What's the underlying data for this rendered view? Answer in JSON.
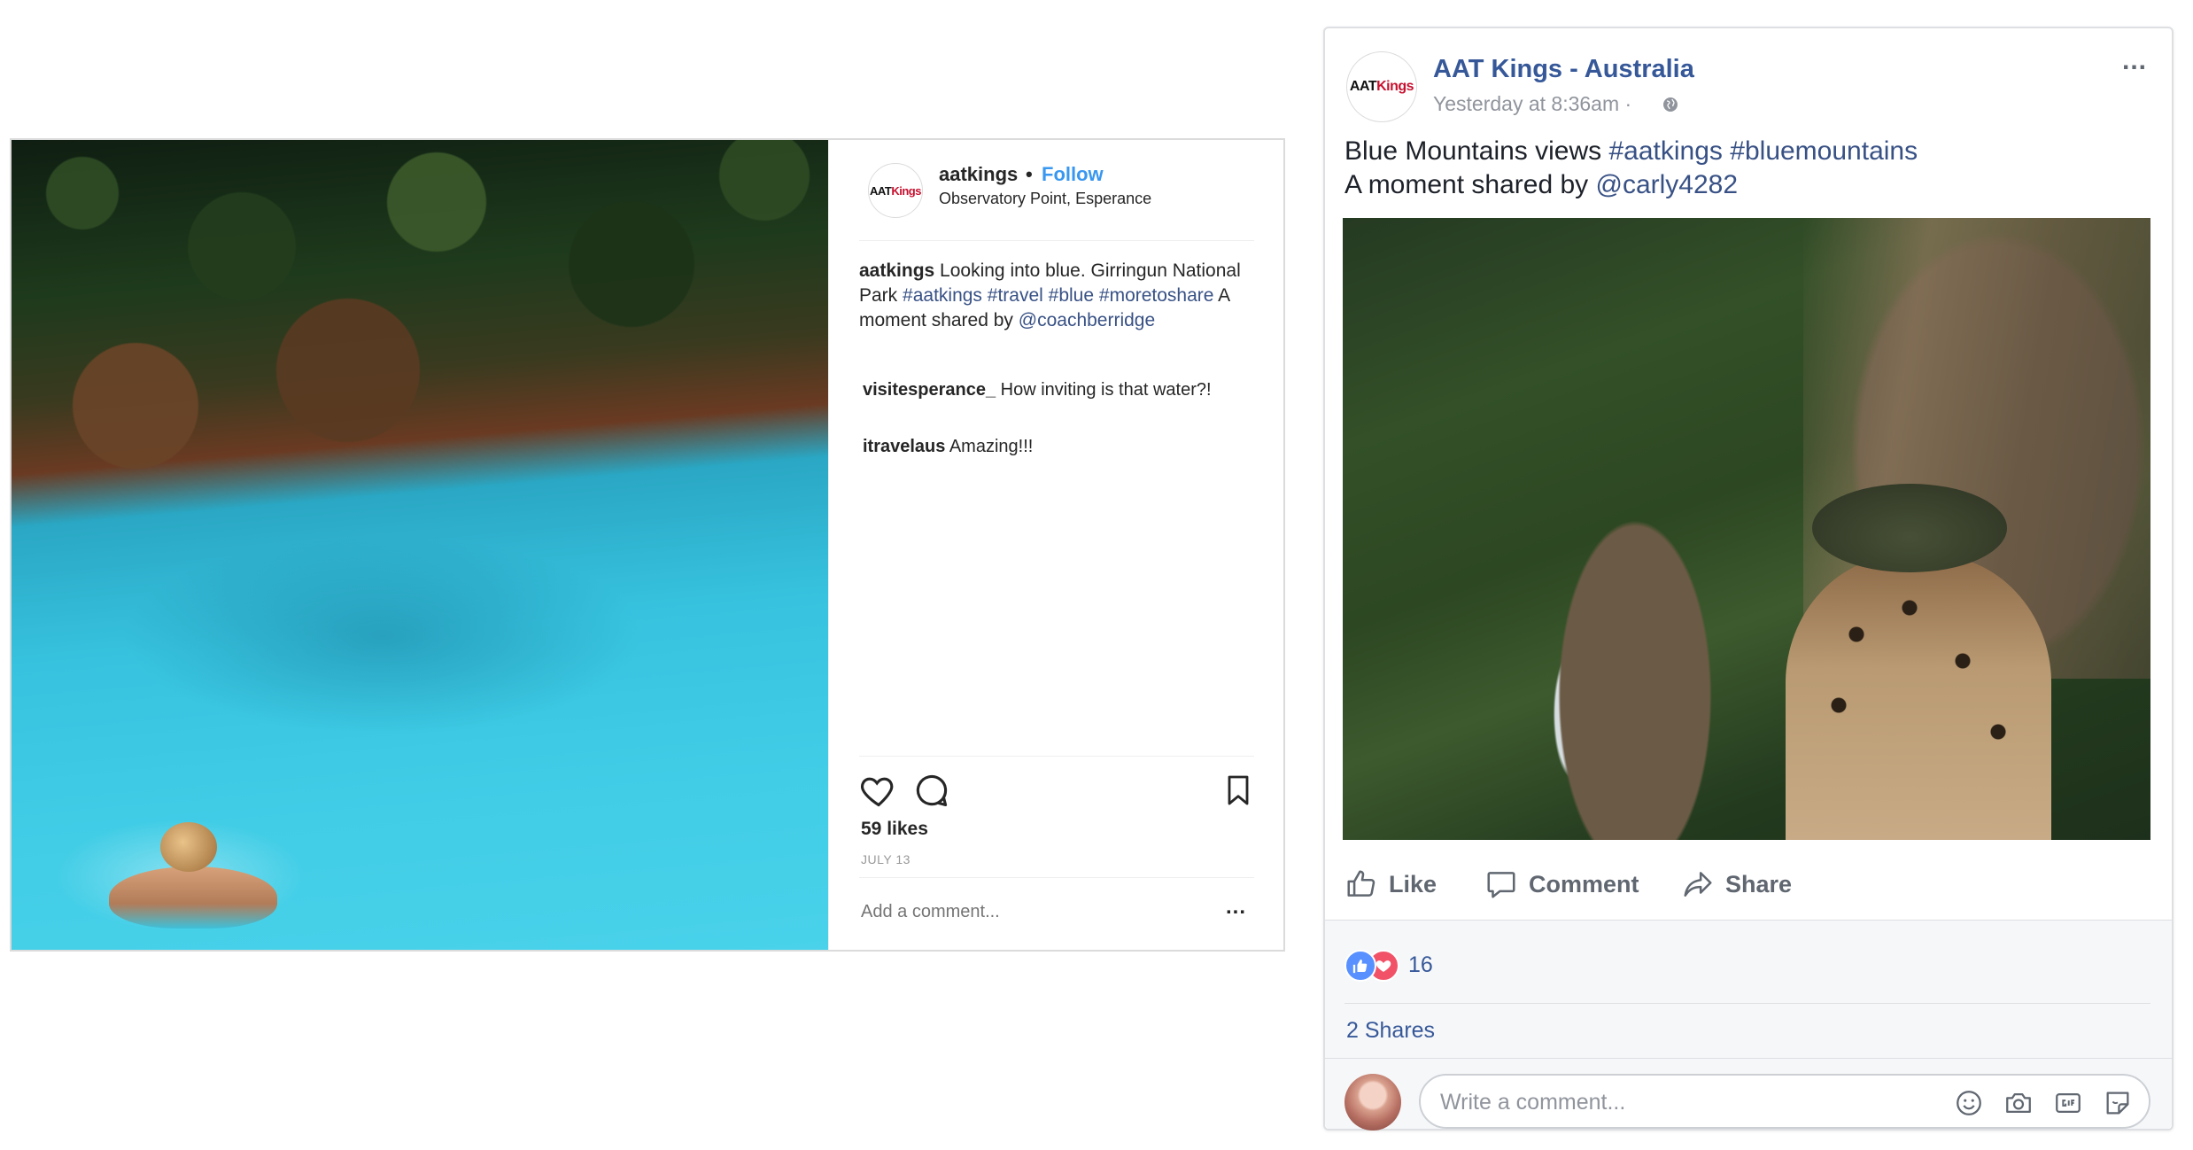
{
  "instagram": {
    "username": "aatkings",
    "separator": "•",
    "follow_label": "Follow",
    "location": "Observatory Point, Esperance",
    "avatar_logo": {
      "part1": "AAT",
      "part2": "Kings"
    },
    "caption": {
      "user": "aatkings",
      "text1": "Looking into blue. Girringun National Park",
      "tag1": "#aatkings",
      "tag2": "#travel",
      "tag3": "#blue",
      "tag4": "#moretoshare",
      "text2": "A moment shared by",
      "mention": "@coachberridge"
    },
    "comments": [
      {
        "user": "visitesperance_",
        "text": "How inviting is that water?!"
      },
      {
        "user": "itravelaus",
        "text": "Amazing!!!"
      }
    ],
    "likes": "59 likes",
    "date": "JULY 13",
    "add_comment_placeholder": "Add a comment...",
    "more_label": "...",
    "icons": [
      "heart-icon",
      "comment-bubble-icon",
      "bookmark-icon"
    ]
  },
  "facebook": {
    "page_name": "AAT Kings - Australia",
    "timestamp": "Yesterday at 8:36am ·",
    "menu_label": "...",
    "avatar_logo": {
      "part1": "AAT",
      "part2": "Kings"
    },
    "post_text": {
      "line1": "Blue Mountains views",
      "tag1": "#aatkings",
      "tag2": "#bluemountains",
      "line2": "A moment shared by",
      "mention": "@carly4282"
    },
    "actions": {
      "like": "Like",
      "comment": "Comment",
      "share": "Share"
    },
    "reaction_count": "16",
    "shares": "2 Shares",
    "comment_placeholder": "Write a comment...",
    "icons": [
      "globe-icon",
      "like-icon",
      "comment-icon",
      "share-icon",
      "emoji-icon",
      "camera-icon",
      "gif-icon",
      "sticker-icon"
    ],
    "colors": {
      "link": "#365899",
      "like_reaction": "#5890ff",
      "love_reaction": "#f25268"
    }
  }
}
